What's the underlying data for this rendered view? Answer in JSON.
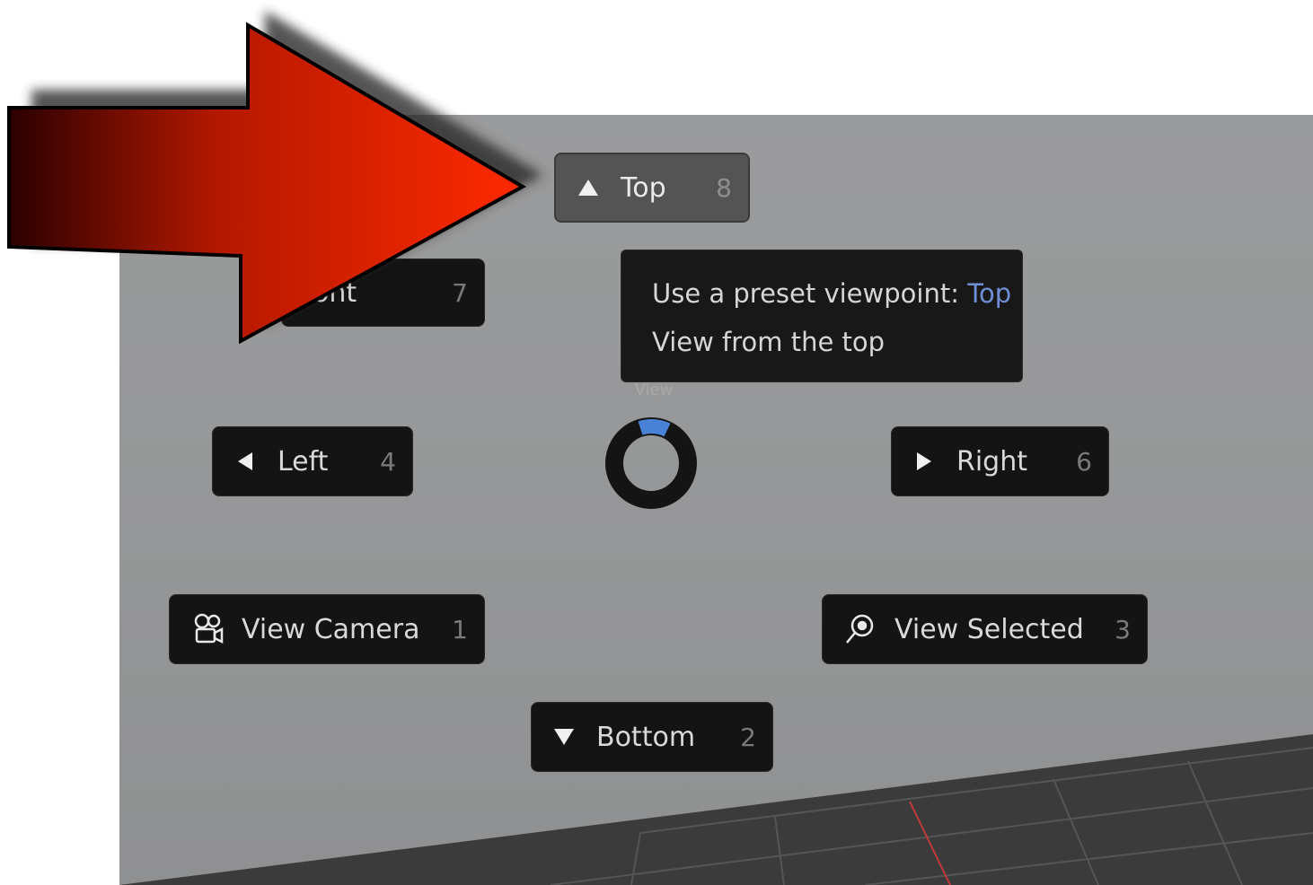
{
  "pie_menu": {
    "top": {
      "label": "Top",
      "shortcut": "8",
      "icon": "triangle-up-icon"
    },
    "front": {
      "label": "Front",
      "visible_text": "ont",
      "shortcut": "7"
    },
    "left": {
      "label": "Left",
      "shortcut": "4",
      "icon": "triangle-left-icon"
    },
    "right": {
      "label": "Right",
      "shortcut": "6",
      "icon": "triangle-right-icon"
    },
    "view_camera": {
      "label": "View Camera",
      "shortcut": "1",
      "icon": "camera-icon"
    },
    "view_selected": {
      "label": "View Selected",
      "shortcut": "3",
      "icon": "zoom-selected-icon"
    },
    "bottom": {
      "label": "Bottom",
      "shortcut": "2",
      "icon": "triangle-down-icon"
    },
    "center_label": "View"
  },
  "tooltip": {
    "line1_prefix": "Use a preset viewpoint:",
    "line1_value": "Top",
    "line2": "View from the top"
  },
  "colors": {
    "accent": "#ff2a00",
    "highlight": "#6e8fd6",
    "button_bg": "#141414",
    "active_bg": "#545454",
    "ring_accent": "#4a82d8"
  }
}
